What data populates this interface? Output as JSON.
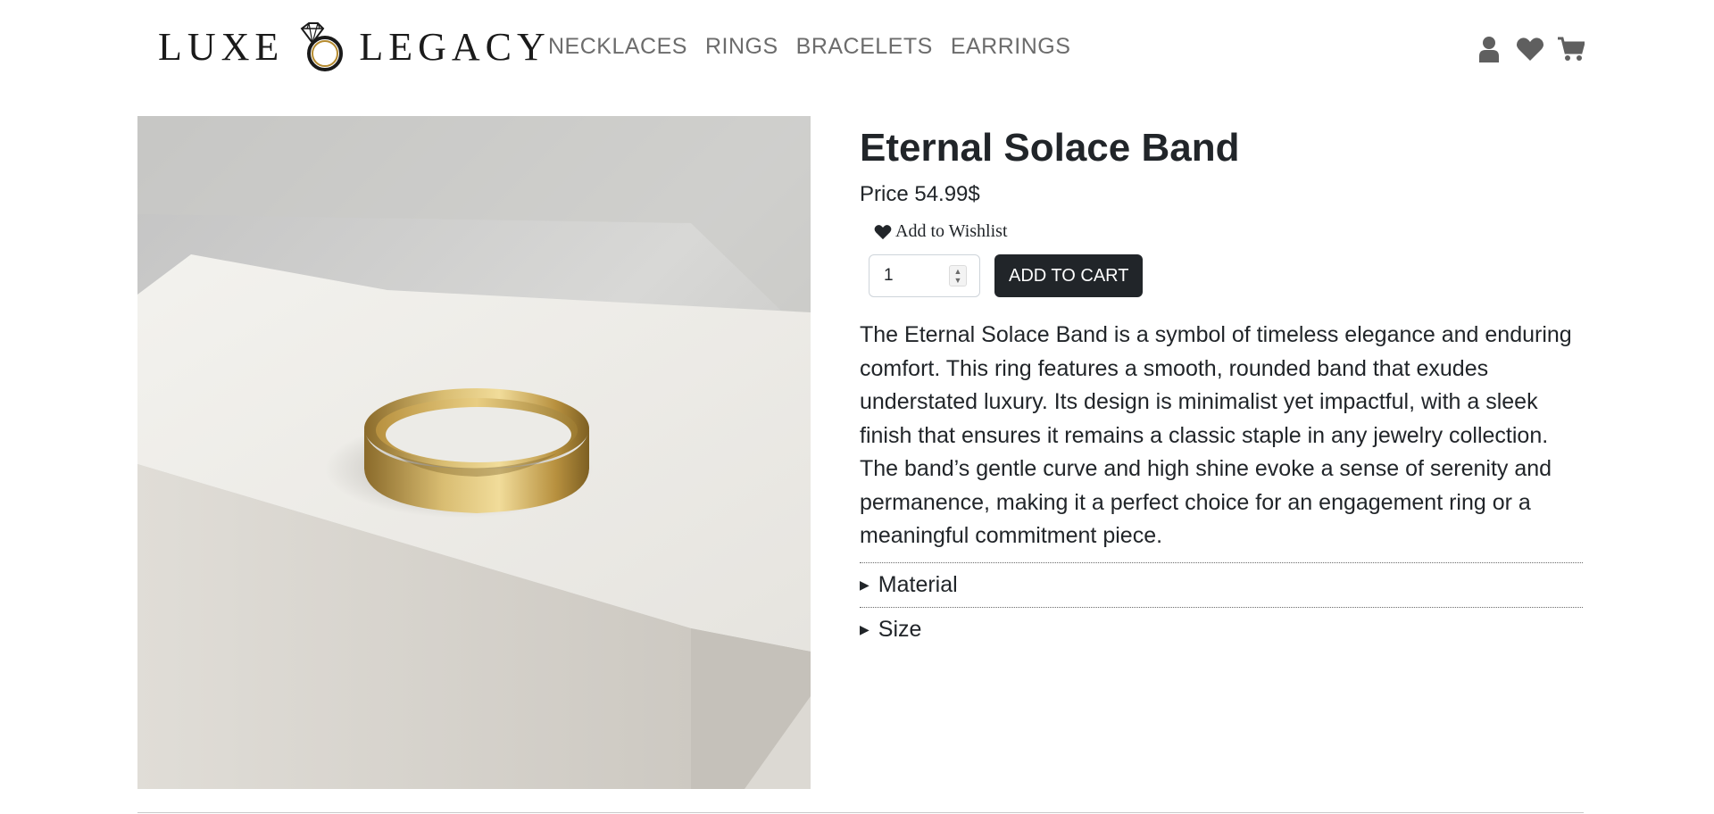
{
  "brand": {
    "name_part1": "LUXE",
    "name_part2": "LEGACY"
  },
  "nav": {
    "items": [
      "NECKLACES",
      "RINGS",
      "BRACELETS",
      "EARRINGS"
    ]
  },
  "header_icons": [
    "user-icon",
    "heart-icon",
    "cart-icon"
  ],
  "product": {
    "title": "Eternal Solace Band",
    "price": "Price 54.99$",
    "wishlist_label": "Add to Wishlist",
    "quantity": "1",
    "add_to_cart_label": "ADD TO CART",
    "description": "The Eternal Solace Band is a symbol of timeless elegance and enduring comfort. This ring features a smooth, rounded band that exudes understated luxury. Its design is minimalist yet impactful, with a sleek finish that ensures it remains a classic staple in any jewelry collection. The band’s gentle curve and high shine evoke a sense of serenity and permanence, making it a perfect choice for an engagement ring or a meaningful commitment piece.",
    "accordion": [
      "Material",
      "Size"
    ]
  },
  "colors": {
    "primary_dark": "#212529",
    "nav_text": "#6c6c6c",
    "ring_gold": "#c9a44a"
  }
}
